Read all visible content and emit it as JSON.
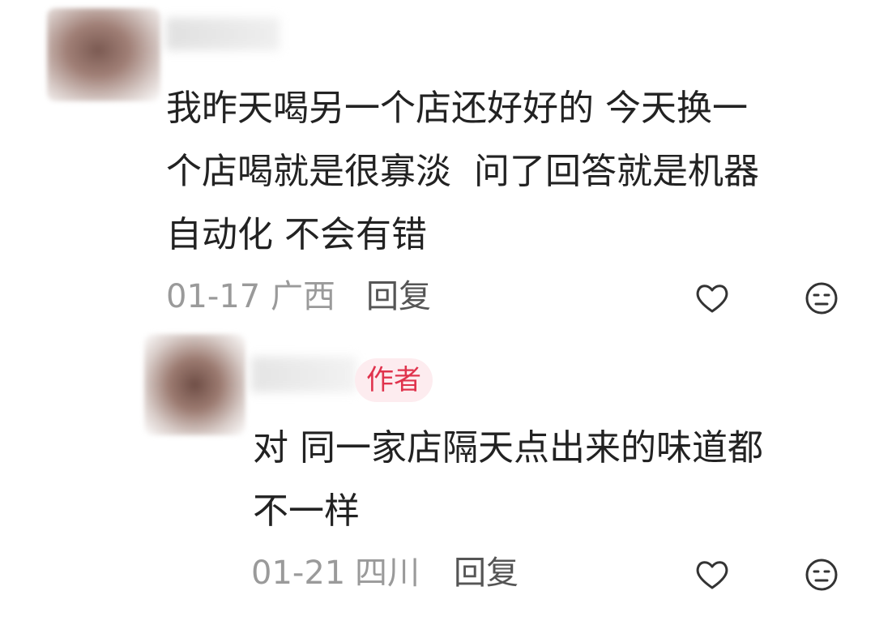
{
  "comments": [
    {
      "lines": [
        "我昨天喝另一个店还好好的 今天换一",
        "个店喝就是很寡淡  问了回答就是机器",
        "自动化 不会有错"
      ],
      "date": "01-17",
      "location": "广西",
      "reply_label": "回复",
      "icons": [
        "heart-icon",
        "meh-face-icon"
      ]
    },
    {
      "badge": "作者",
      "lines": [
        "对 同一家店隔天点出来的味道都",
        "不一样"
      ],
      "date": "01-21",
      "location": "四川",
      "reply_label": "回复",
      "icons": [
        "heart-icon",
        "meh-face-icon"
      ]
    }
  ],
  "colors": {
    "text": "#222222",
    "meta": "#9a9a9a",
    "badge_text": "#e0334d",
    "badge_bg": "#fdecef"
  }
}
